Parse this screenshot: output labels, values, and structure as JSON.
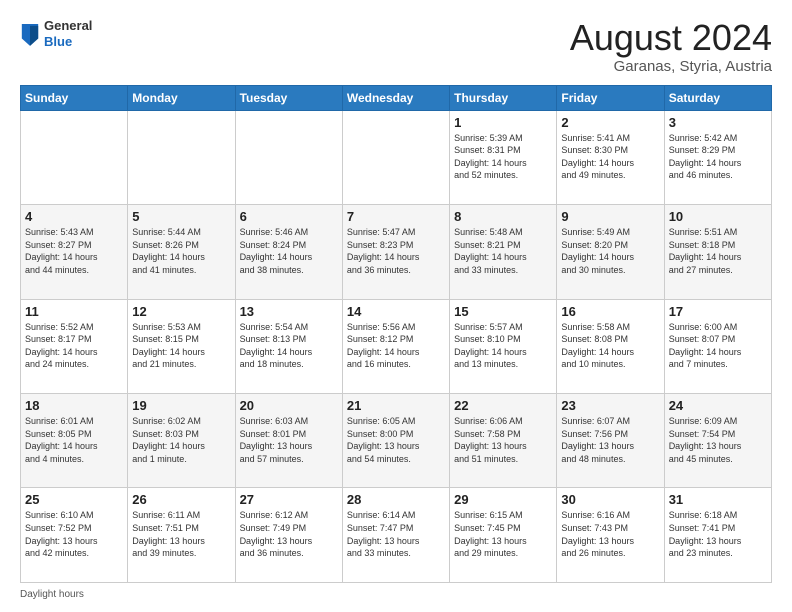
{
  "logo": {
    "general": "General",
    "blue": "Blue"
  },
  "title": "August 2024",
  "subtitle": "Garanas, Styria, Austria",
  "days_of_week": [
    "Sunday",
    "Monday",
    "Tuesday",
    "Wednesday",
    "Thursday",
    "Friday",
    "Saturday"
  ],
  "footer_label": "Daylight hours",
  "weeks": [
    [
      {
        "day": "",
        "info": ""
      },
      {
        "day": "",
        "info": ""
      },
      {
        "day": "",
        "info": ""
      },
      {
        "day": "",
        "info": ""
      },
      {
        "day": "1",
        "info": "Sunrise: 5:39 AM\nSunset: 8:31 PM\nDaylight: 14 hours\nand 52 minutes."
      },
      {
        "day": "2",
        "info": "Sunrise: 5:41 AM\nSunset: 8:30 PM\nDaylight: 14 hours\nand 49 minutes."
      },
      {
        "day": "3",
        "info": "Sunrise: 5:42 AM\nSunset: 8:29 PM\nDaylight: 14 hours\nand 46 minutes."
      }
    ],
    [
      {
        "day": "4",
        "info": "Sunrise: 5:43 AM\nSunset: 8:27 PM\nDaylight: 14 hours\nand 44 minutes."
      },
      {
        "day": "5",
        "info": "Sunrise: 5:44 AM\nSunset: 8:26 PM\nDaylight: 14 hours\nand 41 minutes."
      },
      {
        "day": "6",
        "info": "Sunrise: 5:46 AM\nSunset: 8:24 PM\nDaylight: 14 hours\nand 38 minutes."
      },
      {
        "day": "7",
        "info": "Sunrise: 5:47 AM\nSunset: 8:23 PM\nDaylight: 14 hours\nand 36 minutes."
      },
      {
        "day": "8",
        "info": "Sunrise: 5:48 AM\nSunset: 8:21 PM\nDaylight: 14 hours\nand 33 minutes."
      },
      {
        "day": "9",
        "info": "Sunrise: 5:49 AM\nSunset: 8:20 PM\nDaylight: 14 hours\nand 30 minutes."
      },
      {
        "day": "10",
        "info": "Sunrise: 5:51 AM\nSunset: 8:18 PM\nDaylight: 14 hours\nand 27 minutes."
      }
    ],
    [
      {
        "day": "11",
        "info": "Sunrise: 5:52 AM\nSunset: 8:17 PM\nDaylight: 14 hours\nand 24 minutes."
      },
      {
        "day": "12",
        "info": "Sunrise: 5:53 AM\nSunset: 8:15 PM\nDaylight: 14 hours\nand 21 minutes."
      },
      {
        "day": "13",
        "info": "Sunrise: 5:54 AM\nSunset: 8:13 PM\nDaylight: 14 hours\nand 18 minutes."
      },
      {
        "day": "14",
        "info": "Sunrise: 5:56 AM\nSunset: 8:12 PM\nDaylight: 14 hours\nand 16 minutes."
      },
      {
        "day": "15",
        "info": "Sunrise: 5:57 AM\nSunset: 8:10 PM\nDaylight: 14 hours\nand 13 minutes."
      },
      {
        "day": "16",
        "info": "Sunrise: 5:58 AM\nSunset: 8:08 PM\nDaylight: 14 hours\nand 10 minutes."
      },
      {
        "day": "17",
        "info": "Sunrise: 6:00 AM\nSunset: 8:07 PM\nDaylight: 14 hours\nand 7 minutes."
      }
    ],
    [
      {
        "day": "18",
        "info": "Sunrise: 6:01 AM\nSunset: 8:05 PM\nDaylight: 14 hours\nand 4 minutes."
      },
      {
        "day": "19",
        "info": "Sunrise: 6:02 AM\nSunset: 8:03 PM\nDaylight: 14 hours\nand 1 minute."
      },
      {
        "day": "20",
        "info": "Sunrise: 6:03 AM\nSunset: 8:01 PM\nDaylight: 13 hours\nand 57 minutes."
      },
      {
        "day": "21",
        "info": "Sunrise: 6:05 AM\nSunset: 8:00 PM\nDaylight: 13 hours\nand 54 minutes."
      },
      {
        "day": "22",
        "info": "Sunrise: 6:06 AM\nSunset: 7:58 PM\nDaylight: 13 hours\nand 51 minutes."
      },
      {
        "day": "23",
        "info": "Sunrise: 6:07 AM\nSunset: 7:56 PM\nDaylight: 13 hours\nand 48 minutes."
      },
      {
        "day": "24",
        "info": "Sunrise: 6:09 AM\nSunset: 7:54 PM\nDaylight: 13 hours\nand 45 minutes."
      }
    ],
    [
      {
        "day": "25",
        "info": "Sunrise: 6:10 AM\nSunset: 7:52 PM\nDaylight: 13 hours\nand 42 minutes."
      },
      {
        "day": "26",
        "info": "Sunrise: 6:11 AM\nSunset: 7:51 PM\nDaylight: 13 hours\nand 39 minutes."
      },
      {
        "day": "27",
        "info": "Sunrise: 6:12 AM\nSunset: 7:49 PM\nDaylight: 13 hours\nand 36 minutes."
      },
      {
        "day": "28",
        "info": "Sunrise: 6:14 AM\nSunset: 7:47 PM\nDaylight: 13 hours\nand 33 minutes."
      },
      {
        "day": "29",
        "info": "Sunrise: 6:15 AM\nSunset: 7:45 PM\nDaylight: 13 hours\nand 29 minutes."
      },
      {
        "day": "30",
        "info": "Sunrise: 6:16 AM\nSunset: 7:43 PM\nDaylight: 13 hours\nand 26 minutes."
      },
      {
        "day": "31",
        "info": "Sunrise: 6:18 AM\nSunset: 7:41 PM\nDaylight: 13 hours\nand 23 minutes."
      }
    ]
  ]
}
